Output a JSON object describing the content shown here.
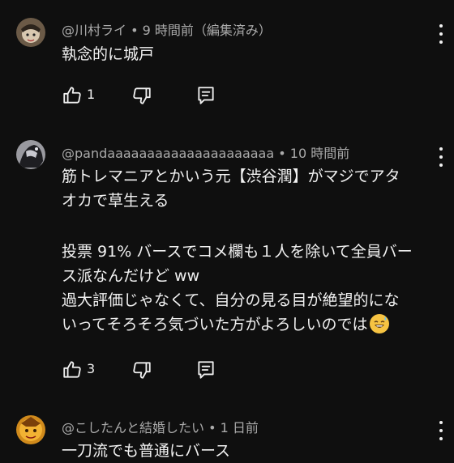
{
  "comments": [
    {
      "author": "@川村ライ",
      "separator": "•",
      "time": "9 時間前（編集済み）",
      "lines": [
        "執念的に城戸"
      ],
      "likes": "1"
    },
    {
      "author": "@pandaaaaaaaaaaaaaaaaaaaaa",
      "separator": "•",
      "time": "10 時間前",
      "lines": [
        "筋トレマニアとかいう元【渋谷潤】がマジでアタ",
        "オカで草生える",
        "",
        "投票 91% バースでコメ欄も１人を除いて全員バー",
        "ス派なんだけど ww",
        "過大評価じゃなくて、自分の見る目が絶望的にな",
        "いってそろそろ気づいた方がよろしいのでは"
      ],
      "emoji": "grinning-sweat-emoji",
      "likes": "3"
    },
    {
      "author": "@こしたんと結婚したい",
      "separator": "•",
      "time": "1 日前",
      "lines": [
        "一刀流でも普通にバース"
      ]
    }
  ],
  "colors": {
    "background": "#0f0f0f",
    "text_primary": "#f1f1f1",
    "text_secondary": "#aaaaaa"
  },
  "icons": [
    "thumb-up-icon",
    "thumb-down-icon",
    "reply-icon",
    "more-vert-icon"
  ]
}
